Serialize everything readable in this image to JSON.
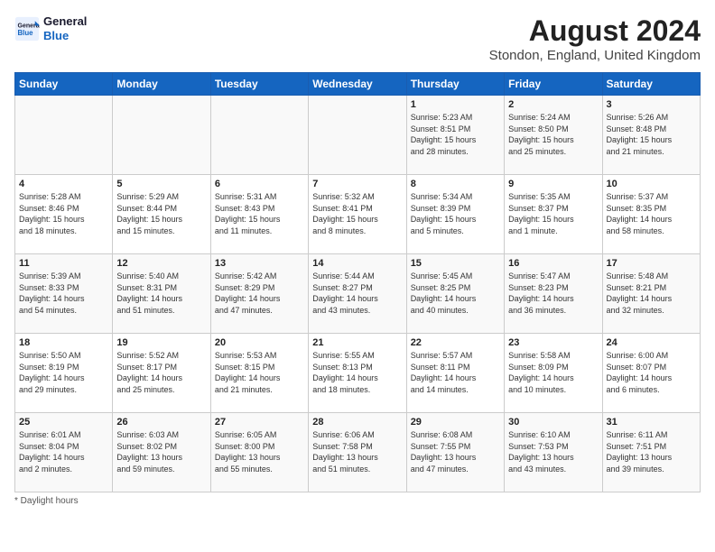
{
  "header": {
    "logo_line1": "General",
    "logo_line2": "Blue",
    "month_title": "August 2024",
    "location": "Stondon, England, United Kingdom"
  },
  "days_of_week": [
    "Sunday",
    "Monday",
    "Tuesday",
    "Wednesday",
    "Thursday",
    "Friday",
    "Saturday"
  ],
  "weeks": [
    [
      {
        "num": "",
        "info": ""
      },
      {
        "num": "",
        "info": ""
      },
      {
        "num": "",
        "info": ""
      },
      {
        "num": "",
        "info": ""
      },
      {
        "num": "1",
        "info": "Sunrise: 5:23 AM\nSunset: 8:51 PM\nDaylight: 15 hours\nand 28 minutes."
      },
      {
        "num": "2",
        "info": "Sunrise: 5:24 AM\nSunset: 8:50 PM\nDaylight: 15 hours\nand 25 minutes."
      },
      {
        "num": "3",
        "info": "Sunrise: 5:26 AM\nSunset: 8:48 PM\nDaylight: 15 hours\nand 21 minutes."
      }
    ],
    [
      {
        "num": "4",
        "info": "Sunrise: 5:28 AM\nSunset: 8:46 PM\nDaylight: 15 hours\nand 18 minutes."
      },
      {
        "num": "5",
        "info": "Sunrise: 5:29 AM\nSunset: 8:44 PM\nDaylight: 15 hours\nand 15 minutes."
      },
      {
        "num": "6",
        "info": "Sunrise: 5:31 AM\nSunset: 8:43 PM\nDaylight: 15 hours\nand 11 minutes."
      },
      {
        "num": "7",
        "info": "Sunrise: 5:32 AM\nSunset: 8:41 PM\nDaylight: 15 hours\nand 8 minutes."
      },
      {
        "num": "8",
        "info": "Sunrise: 5:34 AM\nSunset: 8:39 PM\nDaylight: 15 hours\nand 5 minutes."
      },
      {
        "num": "9",
        "info": "Sunrise: 5:35 AM\nSunset: 8:37 PM\nDaylight: 15 hours\nand 1 minute."
      },
      {
        "num": "10",
        "info": "Sunrise: 5:37 AM\nSunset: 8:35 PM\nDaylight: 14 hours\nand 58 minutes."
      }
    ],
    [
      {
        "num": "11",
        "info": "Sunrise: 5:39 AM\nSunset: 8:33 PM\nDaylight: 14 hours\nand 54 minutes."
      },
      {
        "num": "12",
        "info": "Sunrise: 5:40 AM\nSunset: 8:31 PM\nDaylight: 14 hours\nand 51 minutes."
      },
      {
        "num": "13",
        "info": "Sunrise: 5:42 AM\nSunset: 8:29 PM\nDaylight: 14 hours\nand 47 minutes."
      },
      {
        "num": "14",
        "info": "Sunrise: 5:44 AM\nSunset: 8:27 PM\nDaylight: 14 hours\nand 43 minutes."
      },
      {
        "num": "15",
        "info": "Sunrise: 5:45 AM\nSunset: 8:25 PM\nDaylight: 14 hours\nand 40 minutes."
      },
      {
        "num": "16",
        "info": "Sunrise: 5:47 AM\nSunset: 8:23 PM\nDaylight: 14 hours\nand 36 minutes."
      },
      {
        "num": "17",
        "info": "Sunrise: 5:48 AM\nSunset: 8:21 PM\nDaylight: 14 hours\nand 32 minutes."
      }
    ],
    [
      {
        "num": "18",
        "info": "Sunrise: 5:50 AM\nSunset: 8:19 PM\nDaylight: 14 hours\nand 29 minutes."
      },
      {
        "num": "19",
        "info": "Sunrise: 5:52 AM\nSunset: 8:17 PM\nDaylight: 14 hours\nand 25 minutes."
      },
      {
        "num": "20",
        "info": "Sunrise: 5:53 AM\nSunset: 8:15 PM\nDaylight: 14 hours\nand 21 minutes."
      },
      {
        "num": "21",
        "info": "Sunrise: 5:55 AM\nSunset: 8:13 PM\nDaylight: 14 hours\nand 18 minutes."
      },
      {
        "num": "22",
        "info": "Sunrise: 5:57 AM\nSunset: 8:11 PM\nDaylight: 14 hours\nand 14 minutes."
      },
      {
        "num": "23",
        "info": "Sunrise: 5:58 AM\nSunset: 8:09 PM\nDaylight: 14 hours\nand 10 minutes."
      },
      {
        "num": "24",
        "info": "Sunrise: 6:00 AM\nSunset: 8:07 PM\nDaylight: 14 hours\nand 6 minutes."
      }
    ],
    [
      {
        "num": "25",
        "info": "Sunrise: 6:01 AM\nSunset: 8:04 PM\nDaylight: 14 hours\nand 2 minutes."
      },
      {
        "num": "26",
        "info": "Sunrise: 6:03 AM\nSunset: 8:02 PM\nDaylight: 13 hours\nand 59 minutes."
      },
      {
        "num": "27",
        "info": "Sunrise: 6:05 AM\nSunset: 8:00 PM\nDaylight: 13 hours\nand 55 minutes."
      },
      {
        "num": "28",
        "info": "Sunrise: 6:06 AM\nSunset: 7:58 PM\nDaylight: 13 hours\nand 51 minutes."
      },
      {
        "num": "29",
        "info": "Sunrise: 6:08 AM\nSunset: 7:55 PM\nDaylight: 13 hours\nand 47 minutes."
      },
      {
        "num": "30",
        "info": "Sunrise: 6:10 AM\nSunset: 7:53 PM\nDaylight: 13 hours\nand 43 minutes."
      },
      {
        "num": "31",
        "info": "Sunrise: 6:11 AM\nSunset: 7:51 PM\nDaylight: 13 hours\nand 39 minutes."
      }
    ]
  ],
  "footer": {
    "note": "Daylight hours"
  }
}
